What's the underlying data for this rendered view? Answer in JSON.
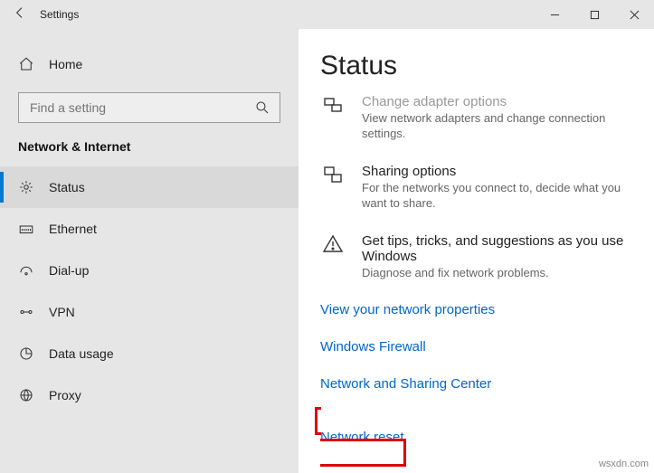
{
  "titlebar": {
    "back_icon_title": "Back",
    "title": "Settings"
  },
  "sidebar": {
    "home_label": "Home",
    "search_placeholder": "Find a setting",
    "category": "Network & Internet",
    "items": [
      {
        "label": "Status"
      },
      {
        "label": "Ethernet"
      },
      {
        "label": "Dial-up"
      },
      {
        "label": "VPN"
      },
      {
        "label": "Data usage"
      },
      {
        "label": "Proxy"
      }
    ]
  },
  "main": {
    "heading": "Status",
    "blocks": [
      {
        "title": "Change adapter options",
        "desc": "View network adapters and change connection settings."
      },
      {
        "title": "Sharing options",
        "desc": "For the networks you connect to, decide what you want to share."
      },
      {
        "title": "Get tips, tricks, and suggestions as you use Windows",
        "desc": "Diagnose and fix network problems."
      }
    ],
    "links": [
      "View your network properties",
      "Windows Firewall",
      "Network and Sharing Center",
      "Network reset"
    ]
  },
  "watermark": "wsxdn.com"
}
